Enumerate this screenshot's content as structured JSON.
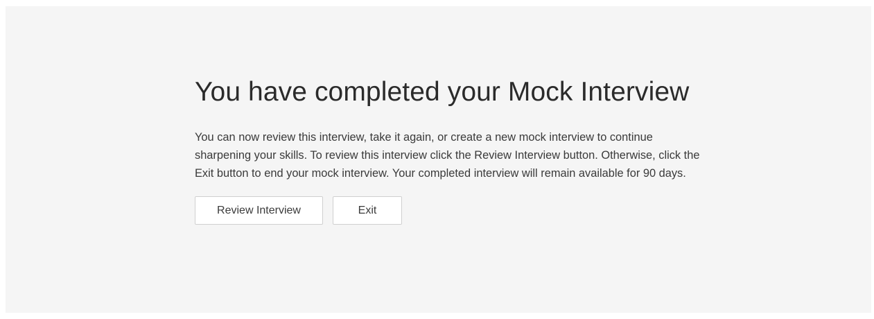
{
  "completion": {
    "title": "You have completed your Mock Interview",
    "description": "You can now review this interview, take it again, or create a new mock interview to continue sharpening your skills. To review this interview click the Review Interview button. Otherwise, click the Exit button to end your mock interview. Your completed interview will remain available for 90 days.",
    "buttons": {
      "review_label": "Review Interview",
      "exit_label": "Exit"
    }
  }
}
